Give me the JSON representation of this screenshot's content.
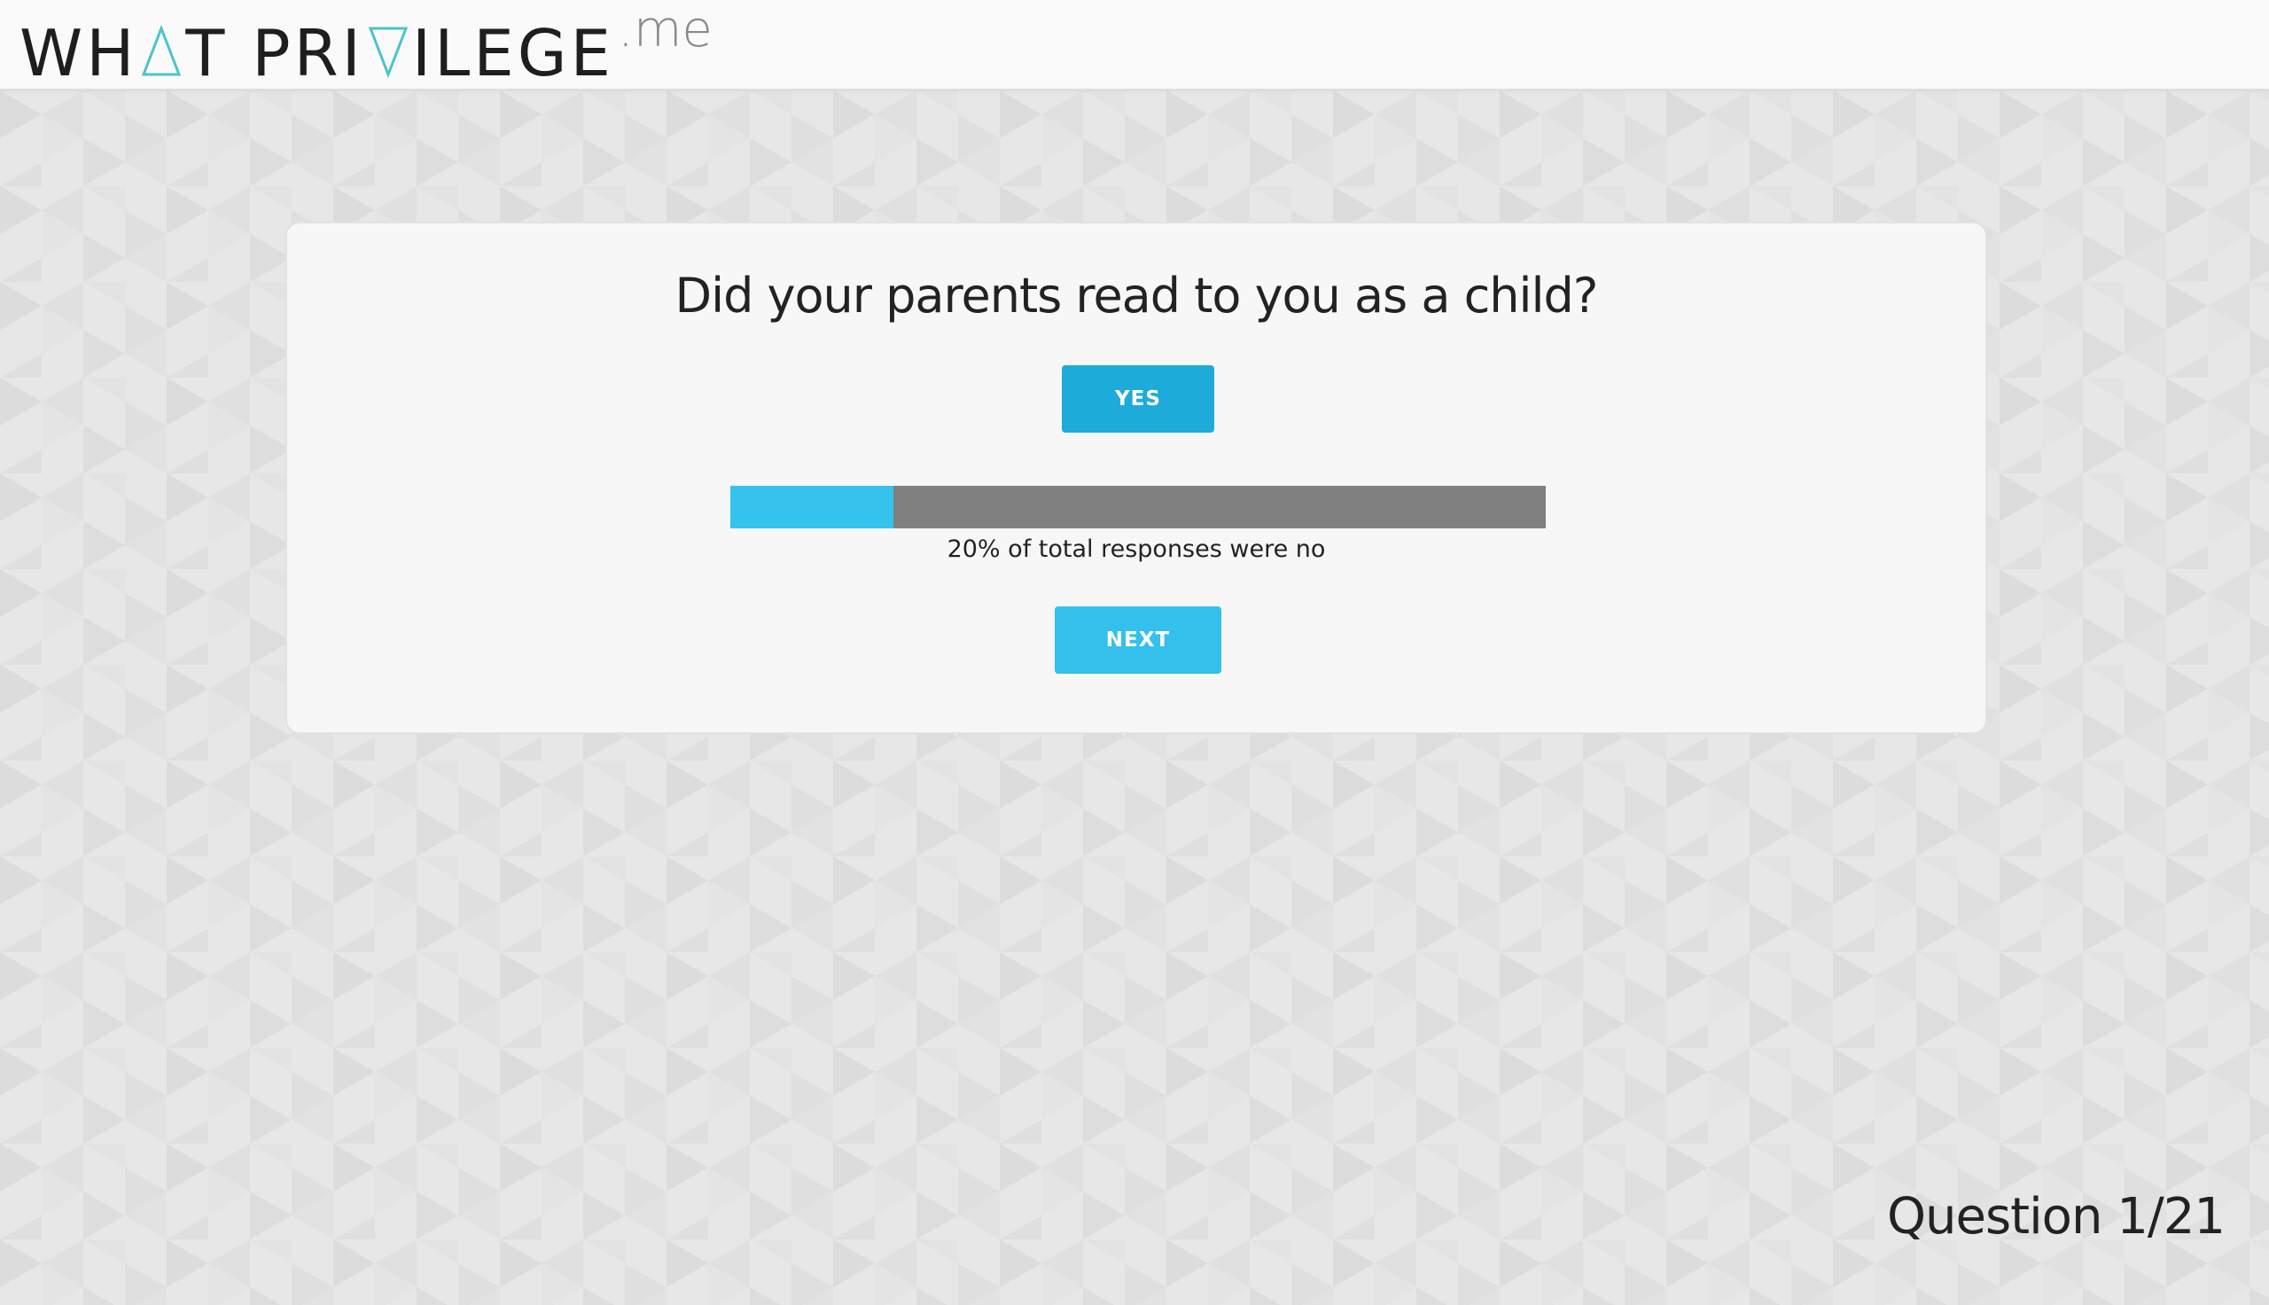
{
  "header": {
    "logo": {
      "part1": "WH",
      "part2": "T PRI",
      "part3": "ILEGE",
      "tld": ".me",
      "accent_color": "#4bc3cd"
    }
  },
  "quiz": {
    "question": "Did your parents read to you as a child?",
    "answer_button_label": "YES",
    "result": {
      "percent_value": 0.2,
      "caption": "20% of total responses were no",
      "fill_color": "#35c3ed",
      "track_color": "#808080"
    },
    "next_button_label": "NEXT"
  },
  "footer": {
    "question_counter": "Question 1/21"
  }
}
